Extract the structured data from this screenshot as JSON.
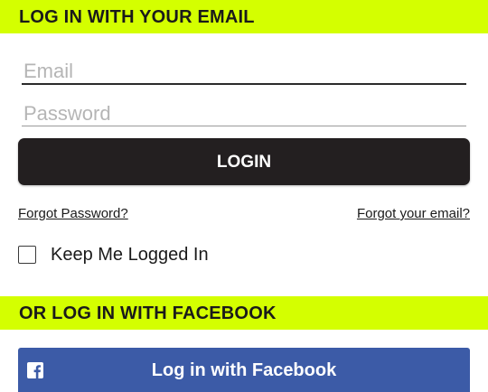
{
  "email_section": {
    "header": "LOG IN WITH YOUR EMAIL",
    "email_placeholder": "Email",
    "password_placeholder": "Password",
    "login_label": "LOGIN",
    "forgot_password": "Forgot Password?",
    "forgot_email": "Forgot your email?",
    "keep_logged_in": "Keep Me Logged In",
    "keep_logged_in_checked": false
  },
  "facebook_section": {
    "header": "OR LOG IN WITH FACEBOOK",
    "button_label": "Log in with Facebook",
    "icon": "facebook-icon"
  },
  "colors": {
    "accent": "#d4ff00",
    "login_button": "#231f20",
    "facebook_button": "#3c5ba7"
  }
}
